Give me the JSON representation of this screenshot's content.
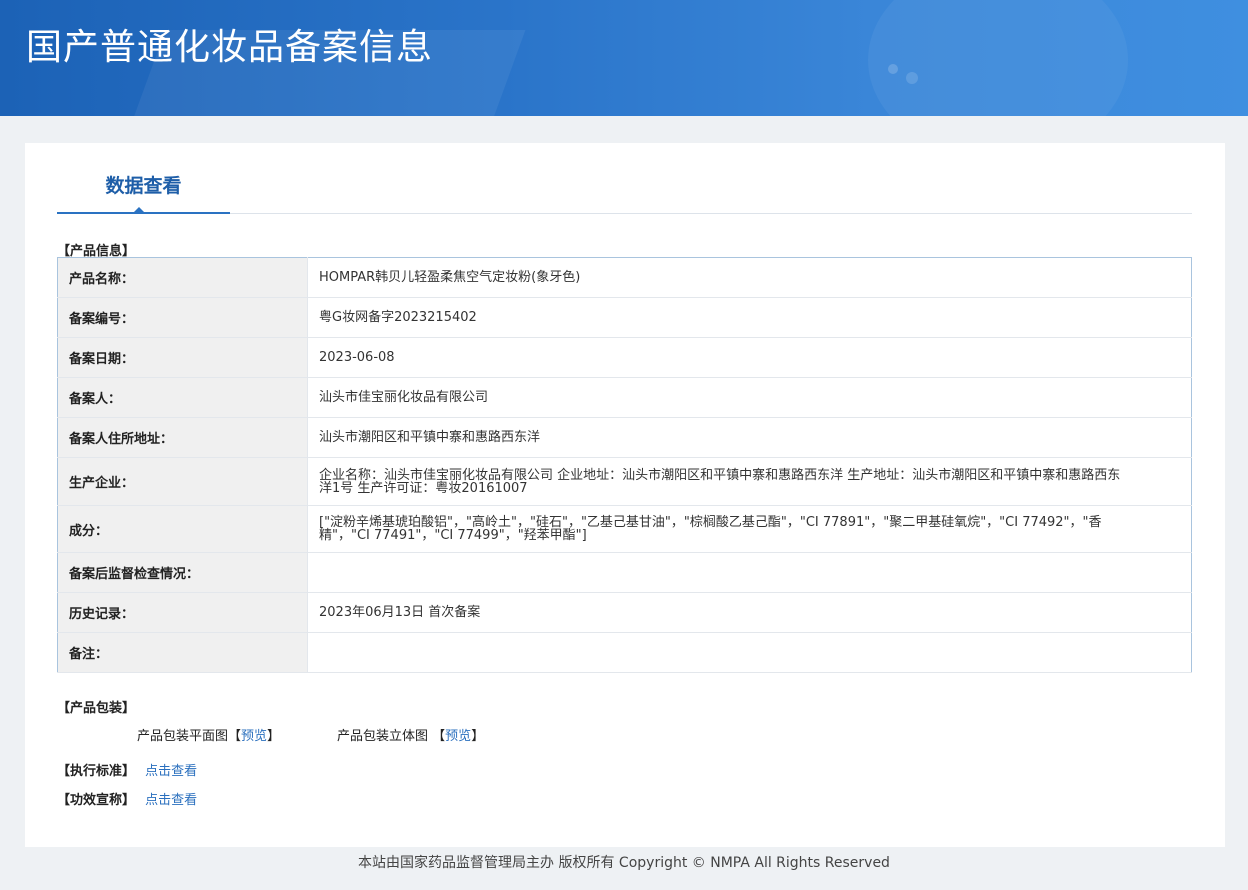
{
  "header": {
    "title": "国产普通化妆品备案信息"
  },
  "tabs": [
    {
      "label": "数据查看"
    }
  ],
  "product_info": {
    "section_title": "【产品信息】",
    "rows": [
      {
        "label": "产品名称：",
        "value": "HOMPAR韩贝儿轻盈柔焦空气定妆粉(象牙色)"
      },
      {
        "label": "备案编号：",
        "value": "粤G妆网备字2023215402"
      },
      {
        "label": "备案日期：",
        "value": "2023-06-08"
      },
      {
        "label": "备案人：",
        "value": "汕头市佳宝丽化妆品有限公司"
      },
      {
        "label": "备案人住所地址：",
        "value": "汕头市潮阳区和平镇中寨和惠路西东洋"
      },
      {
        "label": "生产企业：",
        "value": "企业名称：汕头市佳宝丽化妆品有限公司 企业地址：汕头市潮阳区和平镇中寨和惠路西东洋 生产地址：汕头市潮阳区和平镇中寨和惠路西东洋1号 生产许可证：粤妆20161007"
      },
      {
        "label": "成分：",
        "value": "[\"淀粉辛烯基琥珀酸铝\"，\"高岭土\"，\"硅石\"，\"乙基己基甘油\"，\"棕榈酸乙基己酯\"，\"CI 77891\"，\"聚二甲基硅氧烷\"，\"CI 77492\"，\"香精\"，\"CI 77491\"，\"CI 77499\"，\"羟苯甲酯\"]"
      },
      {
        "label": "备案后监督检查情况：",
        "value": ""
      },
      {
        "label": "历史记录：",
        "value": "2023年06月13日 首次备案"
      },
      {
        "label": "备注：",
        "value": ""
      }
    ]
  },
  "packaging": {
    "section_title": "【产品包装】",
    "flat_label": "产品包装平面图",
    "three_d_label": "产品包装立体图",
    "bracket_open": "【",
    "bracket_close": "】",
    "preview_link": "预览"
  },
  "standard": {
    "label": "【执行标准】",
    "link": "点击查看"
  },
  "efficacy": {
    "label": "【功效宣称】",
    "link": "点击查看"
  },
  "footer": {
    "text": "本站由国家药品监督管理局主办 版权所有 Copyright © NMPA All Rights Reserved"
  }
}
